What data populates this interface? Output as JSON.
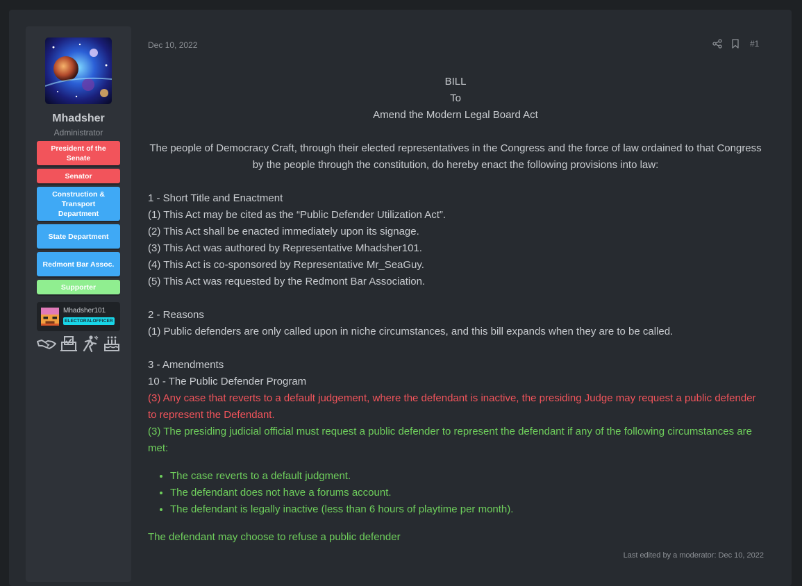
{
  "user": {
    "name": "Mhadsher",
    "title": "Administrator",
    "banners": [
      {
        "label": "President of the Senate",
        "color": "#f2545b"
      },
      {
        "label": "Senator",
        "color": "#f2545b"
      },
      {
        "label": "Construction & Transport Department",
        "color": "#3fa9f5"
      },
      {
        "label": "State Department",
        "color": "#3fa9f5"
      },
      {
        "label": "Redmont Bar Assoc.",
        "color": "#3fa9f5"
      },
      {
        "label": "Supporter",
        "color": "#90ee90"
      }
    ],
    "mc_name": "Mhadsher101",
    "mc_badge": "ELECTORALOFFICER",
    "trophy_icons": [
      "handshake-icon",
      "ballot-box-icon",
      "running-person-icon",
      "birthday-cake-icon"
    ]
  },
  "post": {
    "date": "Dec 10, 2022",
    "number": "#1",
    "action_icons": [
      "share-icon",
      "bookmark-icon"
    ],
    "heading": [
      "BILL",
      "To",
      "Amend the Modern Legal Board Act"
    ],
    "preamble": "The people of Democracy Craft, through their elected representatives in the Congress and the force of law ordained to that Congress by the people through the constitution, do hereby enact the following provisions into law:",
    "section1": {
      "title": "1 - Short Title and Enactment",
      "items": [
        "(1) This Act may be cited as the “Public Defender Utilization Act”.",
        "(2) This Act shall be enacted immediately upon its signage.",
        "(3) This Act was authored by Representative Mhadsher101.",
        "(4) This Act is co-sponsored by Representative Mr_SeaGuy.",
        "(5) This Act was requested by the Redmont Bar Association."
      ]
    },
    "section2": {
      "title": "2 - Reasons",
      "items": [
        "(1) Public defenders are only called upon in niche circumstances, and this bill expands when they are to be called."
      ]
    },
    "section3": {
      "title": "3 - Amendments",
      "subtitle": "10 - The Public Defender Program",
      "removed": "(3) Any case that reverts to a default judgement, where the defendant is inactive, the presiding Judge may request a public defender to represent the Defendant.",
      "added": "(3) The presiding judicial official must request a public defender to represent the defendant if any of the following circumstances are met:",
      "bullets": [
        "The case reverts to a default judgment.",
        "The defendant does not have a forums account.",
        "The defendant is legally inactive (less than 6 hours of playtime per month)."
      ],
      "closing": "The defendant may choose to refuse a public defender"
    },
    "edited": "Last edited by a moderator: Dec 10, 2022",
    "colors": {
      "removed": "#f2545b",
      "added": "#6fcf5c",
      "text": "#c9ccd0"
    }
  }
}
